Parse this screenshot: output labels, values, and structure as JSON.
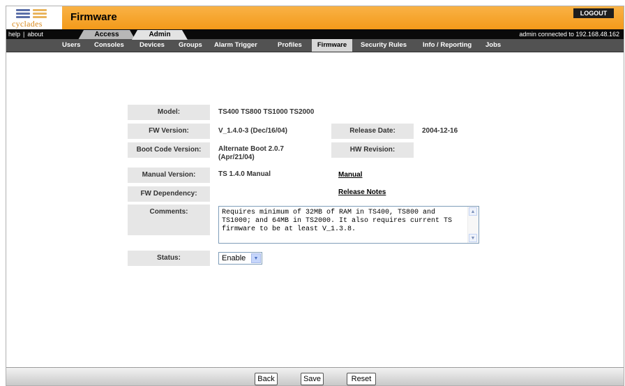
{
  "brand": {
    "logo_text": "cyclades"
  },
  "header": {
    "title": "Firmware",
    "logout_label": "LOGOUT"
  },
  "utility_links": {
    "help": "help",
    "separator": "|",
    "about": "about"
  },
  "top_tabs": [
    {
      "label": "Access",
      "active": false
    },
    {
      "label": "Admin",
      "active": true
    }
  ],
  "connection_status": "admin connected to 192.168.48.162",
  "menu": [
    {
      "label": "Users",
      "active": false
    },
    {
      "label": "Consoles",
      "active": false
    },
    {
      "label": "Devices",
      "active": false
    },
    {
      "label": "Groups",
      "active": false
    },
    {
      "label": "Alarm Trigger",
      "active": false
    },
    {
      "label": "Profiles",
      "active": false
    },
    {
      "label": "Firmware",
      "active": true
    },
    {
      "label": "Security Rules",
      "active": false
    },
    {
      "label": "Info / Reporting",
      "active": false
    },
    {
      "label": "Jobs",
      "active": false
    }
  ],
  "form": {
    "model": {
      "label": "Model:",
      "value": "TS400 TS800 TS1000 TS2000"
    },
    "fw_version": {
      "label": "FW Version:",
      "value": "V_1.4.0-3 (Dec/16/04)"
    },
    "release_date": {
      "label": "Release Date:",
      "value": "2004-12-16"
    },
    "boot_code_version": {
      "label": "Boot Code Version:",
      "value_line1": "Alternate Boot 2.0.7",
      "value_line2": "(Apr/21/04)"
    },
    "hw_revision": {
      "label": "HW Revision:",
      "value": ""
    },
    "manual_version": {
      "label": "Manual Version:",
      "value": "TS 1.4.0 Manual"
    },
    "manual_link": "Manual",
    "fw_dependency": {
      "label": "FW Dependency:",
      "value": ""
    },
    "release_notes_link": "Release Notes",
    "comments": {
      "label": "Comments:",
      "value": "Requires minimum of 32MB of RAM in TS400, TS800 and TS1000; and 64MB in TS2000. It also requires current TS firmware to be at least V_1.3.8."
    },
    "status": {
      "label": "Status:",
      "selected": "Enable"
    }
  },
  "footer": {
    "back_label": "Back",
    "save_label": "Save",
    "reset_label": "Reset"
  },
  "colors": {
    "header_orange": "#f39a1a",
    "menu_bar": "#525252",
    "label_bg": "#e6e6e6",
    "active_tab": "#d7d7d7"
  },
  "icons": [
    "cyclades-logo-icon",
    "scroll-up-icon",
    "scroll-down-icon",
    "dropdown-arrow-icon"
  ]
}
